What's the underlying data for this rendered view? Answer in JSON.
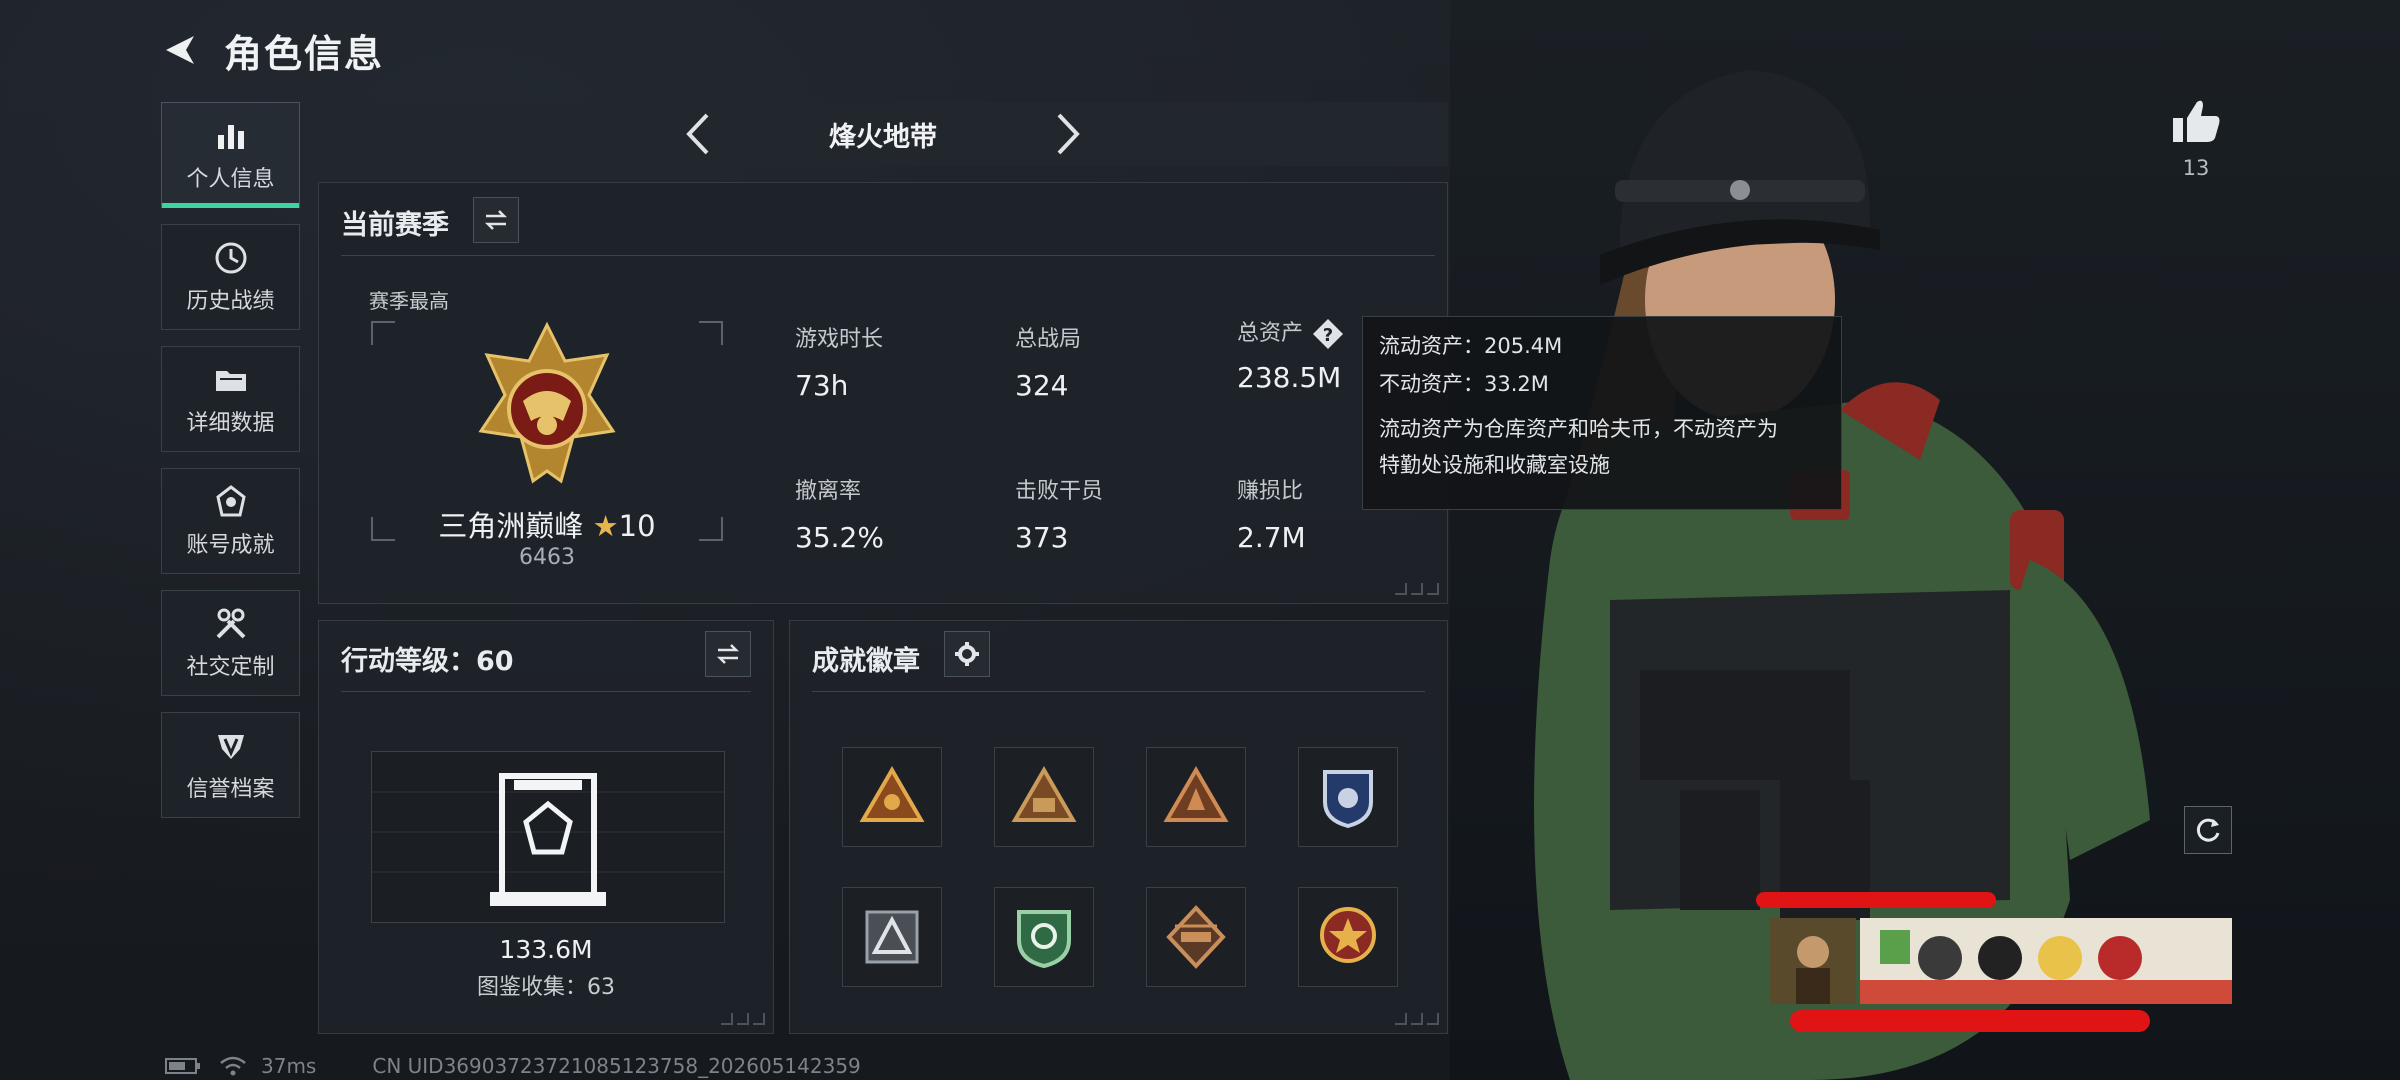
{
  "header": {
    "title": "角色信息"
  },
  "sidebar": {
    "items": [
      {
        "label": "个人信息",
        "icon": "bar-chart-icon",
        "active": true
      },
      {
        "label": "历史战绩",
        "icon": "clock-icon",
        "active": false
      },
      {
        "label": "详细数据",
        "icon": "folder-icon",
        "active": false
      },
      {
        "label": "账号成就",
        "icon": "achievement-icon",
        "active": false
      },
      {
        "label": "社交定制",
        "icon": "wrench-icon",
        "active": false
      },
      {
        "label": "信誉档案",
        "icon": "shield-crest-icon",
        "active": false
      }
    ]
  },
  "tabbar": {
    "title": "烽火地带"
  },
  "season": {
    "title": "当前赛季",
    "best_label": "赛季最高",
    "rank_name": "三角洲巅峰",
    "rank_stars": "10",
    "rank_score": "6463",
    "stats": [
      {
        "label": "游戏时长",
        "value": "73h"
      },
      {
        "label": "总战局",
        "value": "324"
      },
      {
        "label": "总资产",
        "value": "238.5M"
      },
      {
        "label": "撤离率",
        "value": "35.2%"
      },
      {
        "label": "击败干员",
        "value": "373"
      },
      {
        "label": "赚损比",
        "value": "2.7M"
      }
    ]
  },
  "tooltip": {
    "liquid": "流动资产：205.4M",
    "fixed": "不动资产：33.2M",
    "desc_1": "流动资产为仓库资产和哈夫币，不动资产为",
    "desc_2": "特勤处设施和收藏室设施"
  },
  "level": {
    "title": "行动等级：60",
    "value": "133.6M",
    "collection": "图鉴收集：63"
  },
  "badges": {
    "title": "成就徽章",
    "items": [
      "badge-triangle-gold",
      "badge-triangle-team",
      "badge-triangle-plain",
      "badge-police-shield",
      "badge-triangle-silver",
      "badge-green-shield",
      "badge-helicopter",
      "badge-star-emblem"
    ]
  },
  "social": {
    "like_count": "13"
  },
  "status": {
    "ping": "37ms",
    "uid": "CN UID3690372372108512375​8_202605142359"
  },
  "colors": {
    "accent": "#3fd3a2",
    "panel": "#1e2329",
    "text": "#eef0f2",
    "redaction": "#e01414"
  }
}
